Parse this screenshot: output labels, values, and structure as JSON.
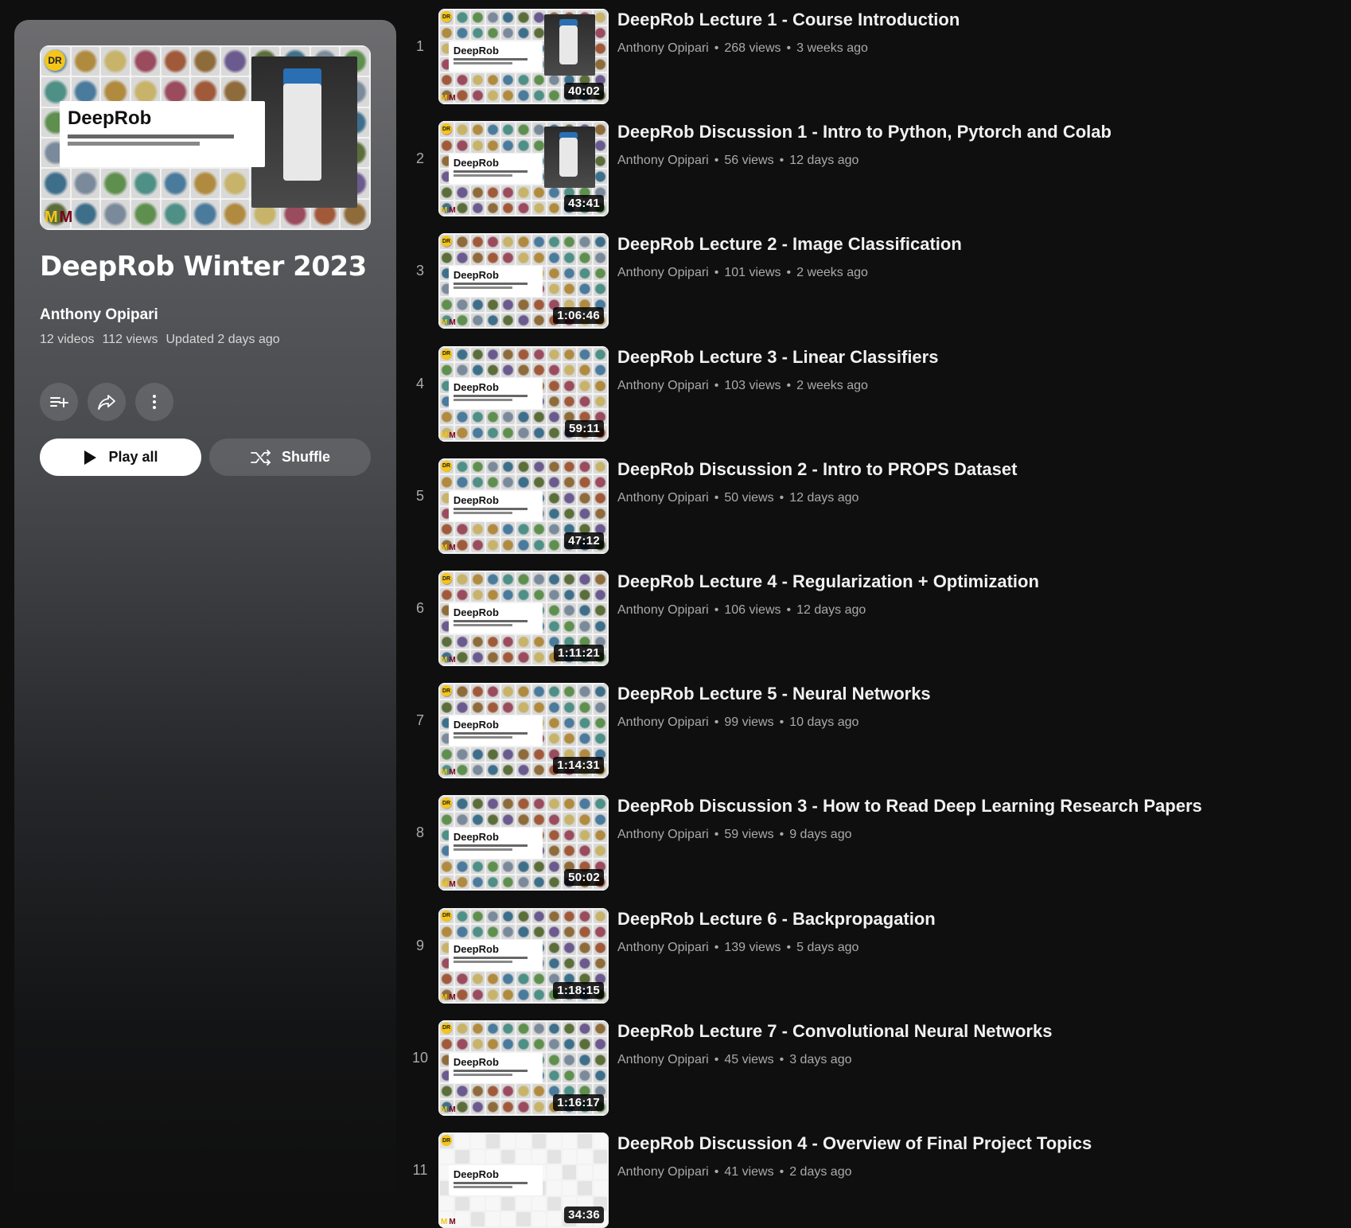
{
  "playlist": {
    "title": "DeepRob Winter 2023",
    "owner": "Anthony Opipari",
    "video_count": "12 videos",
    "views": "112 views",
    "updated": "Updated 2 days ago",
    "play_all_label": "Play all",
    "shuffle_label": "Shuffle",
    "thumbnail": {
      "badge": "DR",
      "brand": "DeepRob",
      "logo_left": "M",
      "logo_right": "M"
    }
  },
  "thumbnail_common": {
    "badge": "DR",
    "brand": "DeepRob",
    "logo_left": "M",
    "logo_right": "M"
  },
  "videos": [
    {
      "index": "1",
      "title": "DeepRob Lecture 1 - Course Introduction",
      "channel": "Anthony Opipari",
      "views": "268 views",
      "age": "3 weeks ago",
      "duration": "40:02"
    },
    {
      "index": "2",
      "title": "DeepRob Discussion 1 - Intro to Python, Pytorch and Colab",
      "channel": "Anthony Opipari",
      "views": "56 views",
      "age": "12 days ago",
      "duration": "43:41"
    },
    {
      "index": "3",
      "title": "DeepRob Lecture 2 - Image Classification",
      "channel": "Anthony Opipari",
      "views": "101 views",
      "age": "2 weeks ago",
      "duration": "1:06:46"
    },
    {
      "index": "4",
      "title": "DeepRob Lecture 3 - Linear Classifiers",
      "channel": "Anthony Opipari",
      "views": "103 views",
      "age": "2 weeks ago",
      "duration": "59:11"
    },
    {
      "index": "5",
      "title": "DeepRob Discussion 2 - Intro to PROPS Dataset",
      "channel": "Anthony Opipari",
      "views": "50 views",
      "age": "12 days ago",
      "duration": "47:12"
    },
    {
      "index": "6",
      "title": "DeepRob Lecture 4 - Regularization + Optimization",
      "channel": "Anthony Opipari",
      "views": "106 views",
      "age": "12 days ago",
      "duration": "1:11:21"
    },
    {
      "index": "7",
      "title": "DeepRob Lecture 5 - Neural Networks",
      "channel": "Anthony Opipari",
      "views": "99 views",
      "age": "10 days ago",
      "duration": "1:14:31"
    },
    {
      "index": "8",
      "title": "DeepRob Discussion 3 - How to Read Deep Learning Research Papers",
      "channel": "Anthony Opipari",
      "views": "59 views",
      "age": "9 days ago",
      "duration": "50:02"
    },
    {
      "index": "9",
      "title": "DeepRob Lecture 6 - Backpropagation",
      "channel": "Anthony Opipari",
      "views": "139 views",
      "age": "5 days ago",
      "duration": "1:18:15"
    },
    {
      "index": "10",
      "title": "DeepRob Lecture 7 - Convolutional Neural Networks",
      "channel": "Anthony Opipari",
      "views": "45 views",
      "age": "3 days ago",
      "duration": "1:16:17"
    },
    {
      "index": "11",
      "title": "DeepRob Discussion 4 - Overview of Final Project Topics",
      "channel": "Anthony Opipari",
      "views": "41 views",
      "age": "2 days ago",
      "duration": "34:36"
    }
  ],
  "icons": {
    "save": "playlist-add-icon",
    "share": "share-icon",
    "more": "more-vert-icon",
    "play": "play-icon",
    "shuffle": "shuffle-icon"
  },
  "colors": {
    "background": "#0f0f0f",
    "text_primary": "#f1f1f1",
    "text_secondary": "#aaaaaa",
    "michigan_maize": "#f5c518",
    "minnesota_maroon": "#7a0019"
  }
}
